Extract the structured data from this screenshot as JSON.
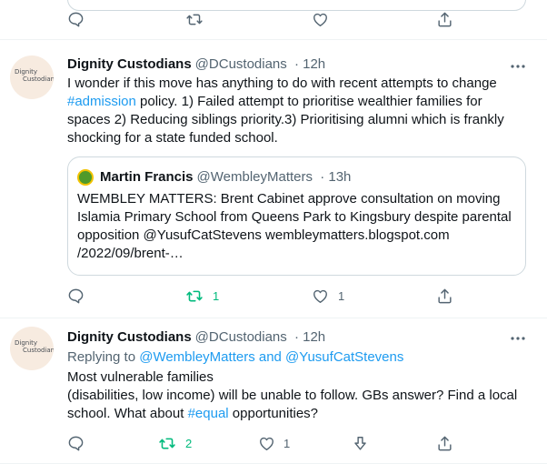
{
  "top_row": {
    "actions": [
      "reply",
      "retweet",
      "like",
      "share"
    ]
  },
  "tweets": [
    {
      "author_name": "Dignity Custodians",
      "author_handle": "@DCustodians",
      "time": "· 12h",
      "avatar_text": [
        "Dignity",
        "Custodians"
      ],
      "text_parts": {
        "p1": "I wonder if this move has anything to do with recent attempts to change",
        "tag": "#admission",
        "p2": " policy. 1) Failed attempt to prioritise wealthier families for spaces 2) Reducing siblings priority.3) Prioritising alumni which is frankly shocking for a state funded school."
      },
      "quote": {
        "author_name": "Martin Francis",
        "author_handle": "@WembleyMatters",
        "time": "· 13h",
        "text": "WEMBLEY MATTERS: Brent Cabinet approve consultation on moving Islamia Primary School from Queens Park to Kingsbury despite parental opposition   @YusufCatStevens wembleymatters.blogspot.com /2022/09/brent-…"
      },
      "actions": {
        "retweets": "1",
        "likes": "1"
      }
    },
    {
      "author_name": "Dignity Custodians",
      "author_handle": "@DCustodians",
      "time": "· 12h",
      "avatar_text": [
        "Dignity",
        "Custodians"
      ],
      "replying_label": "Replying to ",
      "replying_to": "@WembleyMatters and @YusufCatStevens",
      "text_parts": {
        "p1": "Most vulnerable families",
        "p2": "(disabilities, low income) will be unable to follow. GBs answer? Find a local school. What about ",
        "tag": "#equal",
        "p3": " opportunities?"
      },
      "actions": {
        "retweets": "2",
        "likes": "1"
      }
    }
  ],
  "icons": {
    "reply": "reply-icon",
    "retweet": "retweet-icon",
    "like": "heart-icon",
    "share": "share-icon",
    "downvote": "downvote-icon",
    "more": "more-icon"
  },
  "colors": {
    "accent": "#1d9bf0",
    "retweet_active": "#00ba7c",
    "muted": "#536471"
  }
}
